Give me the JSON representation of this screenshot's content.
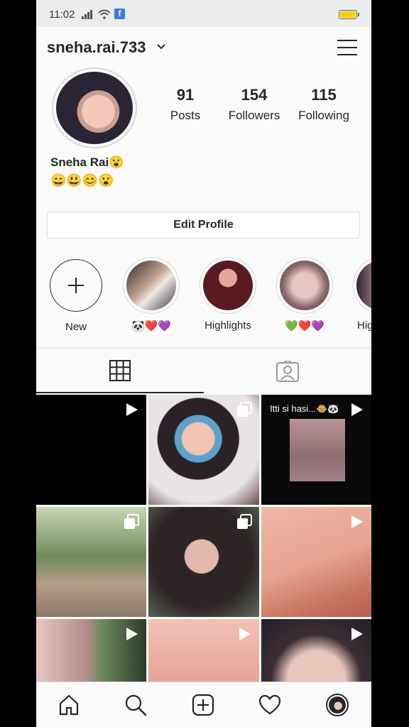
{
  "status_bar": {
    "time": "11:02"
  },
  "header": {
    "username": "sneha.rai.733"
  },
  "profile": {
    "stats": [
      {
        "value": "91",
        "label": "Posts"
      },
      {
        "value": "154",
        "label": "Followers"
      },
      {
        "value": "115",
        "label": "Following"
      }
    ],
    "bio_name": "Sneha Rai😮",
    "bio_emojis": "😄😃😊😮"
  },
  "edit_profile_label": "Edit Profile",
  "highlights": [
    {
      "label": "New"
    },
    {
      "label": "🐼❤️💜"
    },
    {
      "label": "Highlights"
    },
    {
      "label": "💚❤️💜"
    },
    {
      "label": "Hig"
    }
  ],
  "grid_posts": [
    {
      "type": "video",
      "caption": ""
    },
    {
      "type": "multiple",
      "caption": ""
    },
    {
      "type": "video",
      "caption": "Itti si hasi...🐵🐼"
    },
    {
      "type": "multiple",
      "caption": ""
    },
    {
      "type": "multiple",
      "caption": ""
    },
    {
      "type": "video",
      "caption": ""
    },
    {
      "type": "video",
      "caption": ""
    },
    {
      "type": "video",
      "caption": ""
    },
    {
      "type": "video",
      "caption": ""
    }
  ],
  "bottom_nav": [
    "home-icon",
    "search-icon",
    "add-icon",
    "heart-icon",
    "profile-avatar"
  ]
}
